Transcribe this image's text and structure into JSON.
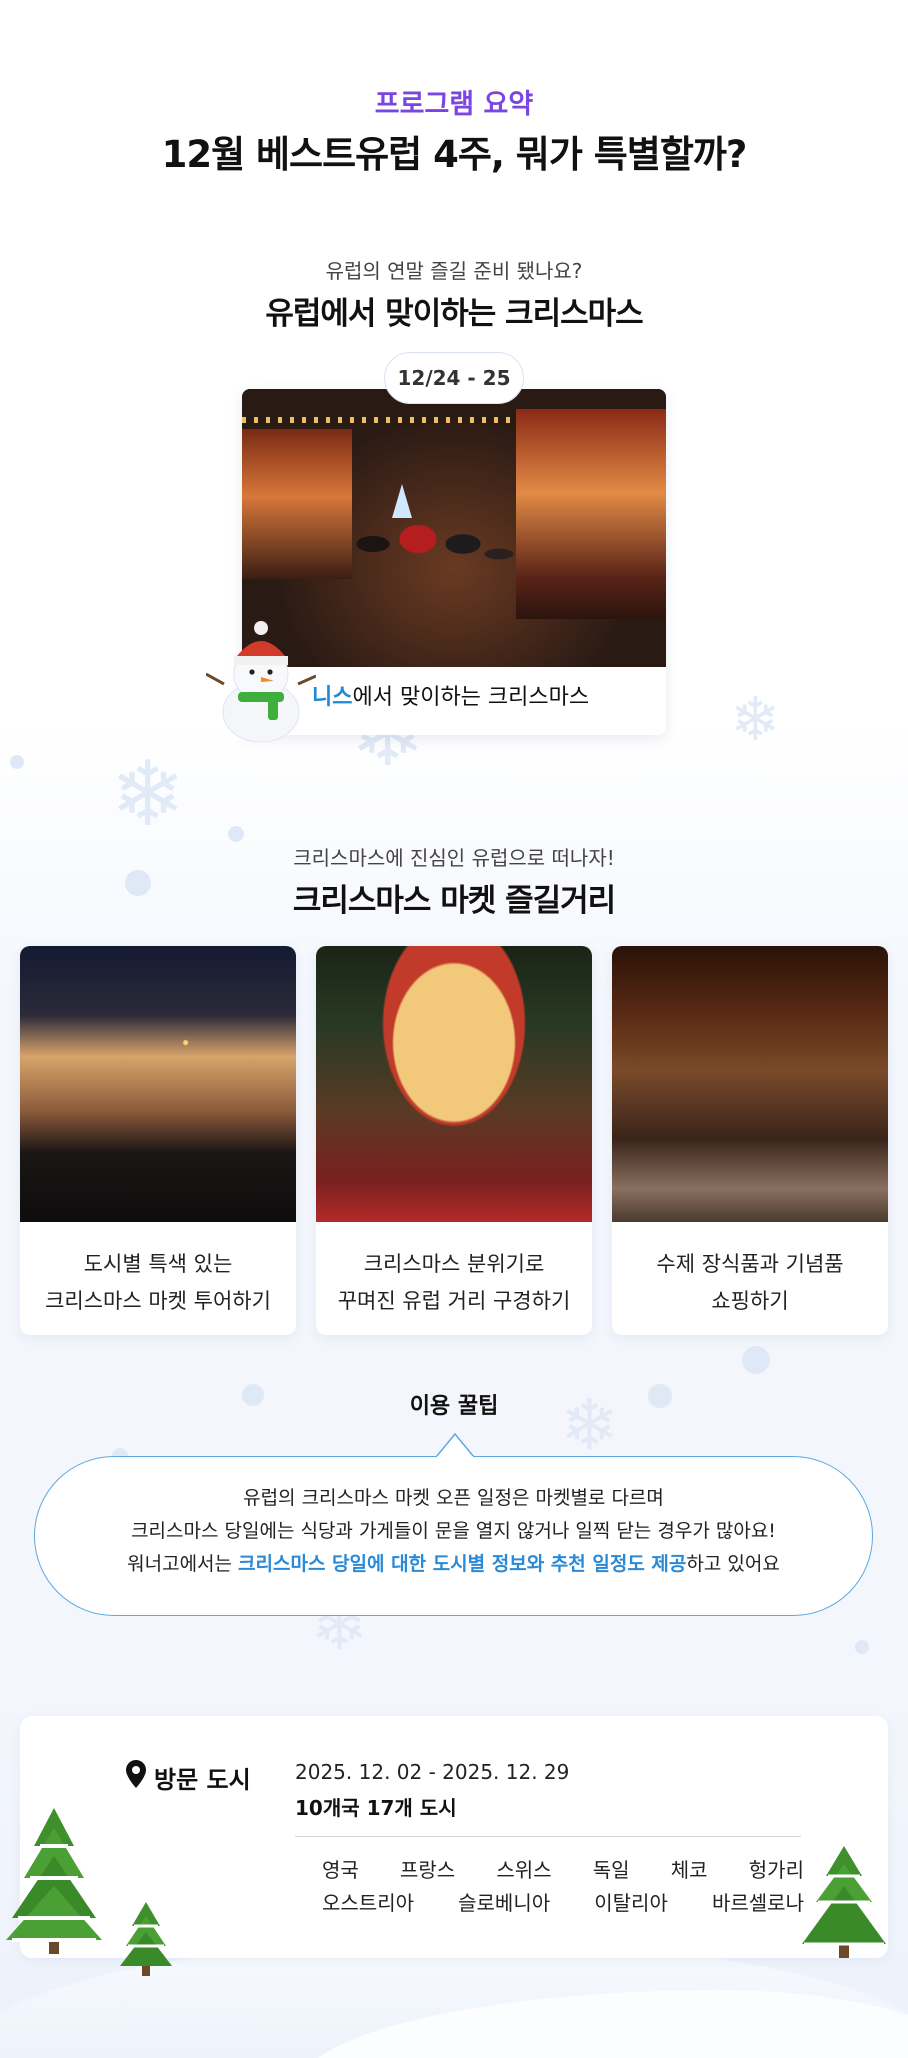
{
  "header": {
    "eyebrow": "프로그램 요약",
    "title": "12월 베스트유럽 4주, 뭐가 특별할까?"
  },
  "christmas_section": {
    "subtitle": "유럽의 연말 즐길 준비 됐나요?",
    "title": "유럽에서 맞이하는 크리스마스",
    "date_badge": "12/24 - 25",
    "caption_highlight": "니스",
    "caption_rest": "에서 맞이하는 크리스마스"
  },
  "market_section": {
    "subtitle": "크리스마스에 진심인 유럽으로 떠나자!",
    "title": "크리스마스 마켓 즐길거리",
    "cards": [
      {
        "line1": "도시별 특색 있는",
        "line2": "크리스마스 마켓 투어하기"
      },
      {
        "line1": "크리스마스 분위기로",
        "line2": "꾸며진 유럽 거리 구경하기"
      },
      {
        "line1": "수제 장식품과 기념품",
        "line2": "쇼핑하기"
      }
    ]
  },
  "tips": {
    "title": "이용 꿀팁",
    "line1": "유럽의 크리스마스 마켓 오픈 일정은 마켓별로 다르며",
    "line2": "크리스마스 당일에는 식당과 가게들이 문을 열지 않거나 일찍 닫는 경우가 많아요!",
    "line3_pre": "워너고에서는 ",
    "line3_highlight": "크리스마스 당일에 대한 도시별 정보와 추천 일정도 제공",
    "line3_post": "하고 있어요"
  },
  "visit": {
    "label": "방문 도시",
    "dates": "2025. 12. 02 - 2025. 12. 29",
    "summary": "10개국 17개 도시",
    "countries_row1": [
      "영국",
      "프랑스",
      "스위스",
      "독일",
      "체코",
      "헝가리"
    ],
    "countries_row2": [
      "오스트리아",
      "슬로베니아",
      "이탈리아",
      "바르셀로나"
    ]
  },
  "colors": {
    "accent_purple": "#7a45e0",
    "accent_blue": "#1e88d6"
  },
  "icons": {
    "pin": "location-pin-icon",
    "snowman": "snowman-icon",
    "tree": "christmas-tree-icon"
  }
}
